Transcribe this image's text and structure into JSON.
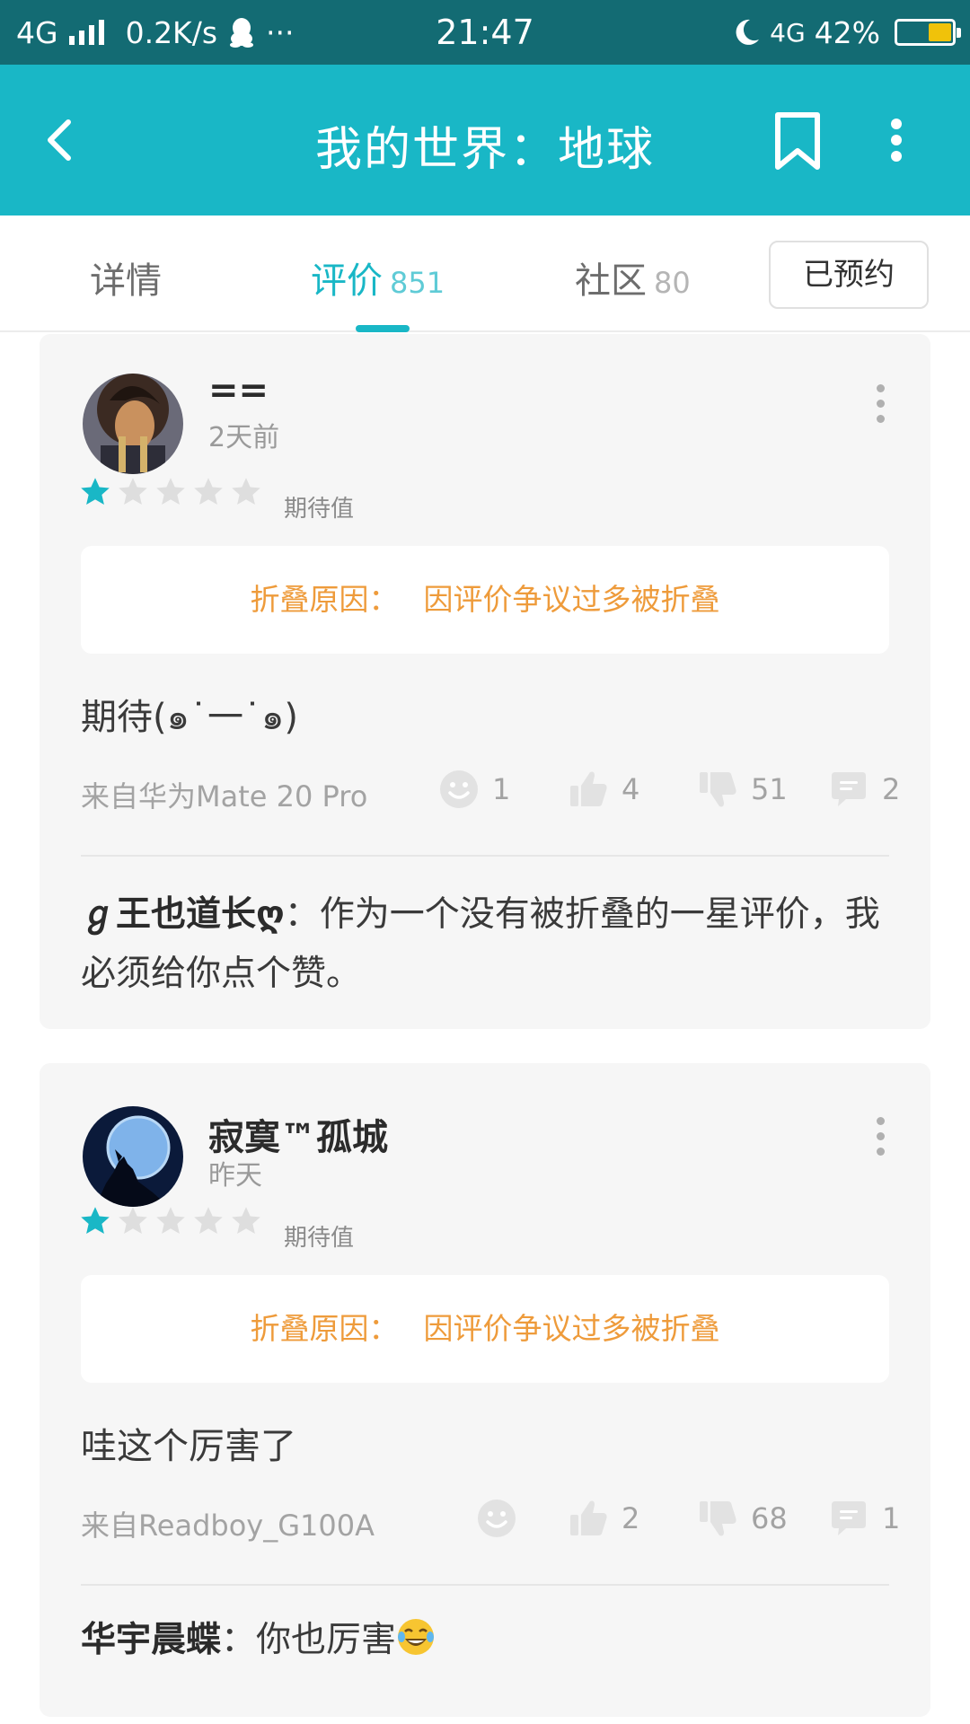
{
  "status_bar": {
    "network": "4G",
    "speed": "0.2K/s",
    "ellipsis": "···",
    "time": "21:47",
    "network_right": "4G",
    "battery": "42%",
    "battery_level": 0.42
  },
  "app_bar": {
    "title": "我的世界：地球"
  },
  "tabs": {
    "items": [
      {
        "label": "详情",
        "count": ""
      },
      {
        "label": "评价",
        "count": "851"
      },
      {
        "label": "社区",
        "count": "80"
      }
    ],
    "active_index": 1,
    "reserve_label": "已预约"
  },
  "colors": {
    "accent": "#19b7c6",
    "status_bar": "#136b73",
    "fold_text": "#ee9b3b",
    "star_on": "#19b7c6",
    "star_off": "#dedede"
  },
  "reviews": [
    {
      "username": "==",
      "time": "2天前",
      "rating": 1,
      "max_rating": 5,
      "rating_label": "期待值",
      "fold_prefix": "折叠原因：",
      "fold_reason": "因评价争议过多被折叠",
      "text": "期待(๑˙一˙๑)",
      "device": "来自华为Mate 20 Pro",
      "funny": "1",
      "likes": "4",
      "dislikes": "51",
      "comments": "2",
      "reply_name": "ℊ王也道长ღ",
      "reply_sep": "：",
      "reply_text": "作为一个没有被折叠的一星评价，我必须给你点个赞。"
    },
    {
      "username": "寂寞™孤城",
      "time": "昨天",
      "rating": 1,
      "max_rating": 5,
      "rating_label": "期待值",
      "fold_prefix": "折叠原因：",
      "fold_reason": "因评价争议过多被折叠",
      "text": "哇这个厉害了",
      "device": "来自Readboy_G100A",
      "funny": "",
      "likes": "2",
      "dislikes": "68",
      "comments": "1",
      "reply_name": "华宇晨蝶",
      "reply_sep": "：",
      "reply_text": "你也厉害",
      "reply_emoji": "laughing-crying-emoji"
    }
  ]
}
